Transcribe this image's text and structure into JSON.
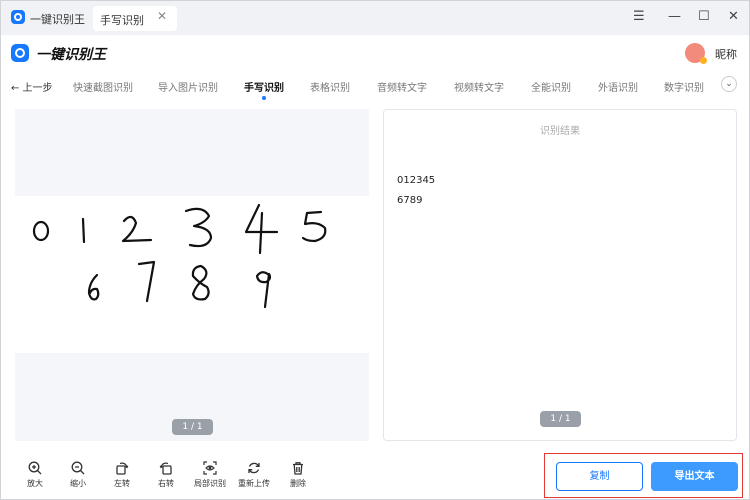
{
  "titlebar": {
    "app_name": "一键识别王",
    "tab_label": "手写识别",
    "tab_close": "✕",
    "menu": "☰",
    "minimize": "—",
    "maximize": "☐",
    "close": "✕"
  },
  "header": {
    "brand": "一键识别王",
    "nickname": "昵称"
  },
  "nav": {
    "back": "← 上一步",
    "items": [
      "快速截图识别",
      "导入图片识别",
      "手写识别",
      "表格识别",
      "音频转文字",
      "视频转文字",
      "全能识别",
      "外语识别",
      "数字识别"
    ],
    "active": "手写识别",
    "more": "⌄"
  },
  "image_panel": {
    "pager": "1 / 1"
  },
  "result_panel": {
    "title": "识别结果",
    "lines": [
      "012345",
      "6789"
    ],
    "pager": "1 / 1"
  },
  "toolbar": {
    "zoom_in": "放大",
    "zoom_out": "缩小",
    "rotate_left": "左转",
    "rotate_right": "右转",
    "region_ocr": "局部识别",
    "reupload": "重新上传",
    "delete": "删除"
  },
  "actions": {
    "copy": "复制",
    "export": "导出文本"
  },
  "colors": {
    "accent": "#1677ff",
    "export_button": "#3d9bff",
    "highlight_border": "#e53935"
  }
}
